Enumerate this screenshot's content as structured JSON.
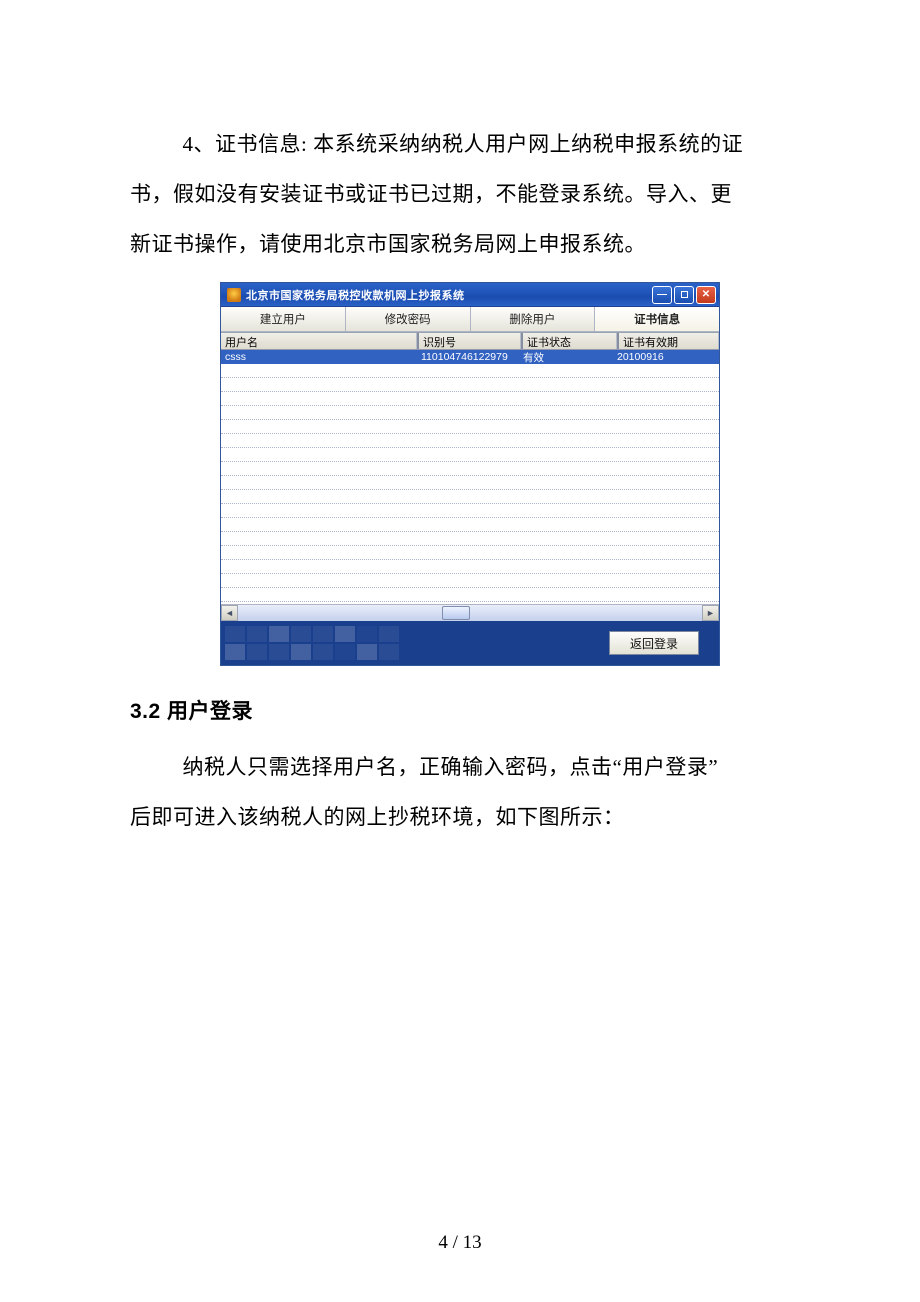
{
  "doc": {
    "p1_indent": "4、证书信息: 本系统采纳纳税人用户网上纳税申报系统的证",
    "p1_l2": "书，假如没有安装证书或证书已过期，不能登录系统。导入、更",
    "p1_l3": "新证书操作，请使用北京市国家税务局网上申报系统。",
    "h32": "3.2 用户登录",
    "p2_indent": "纳税人只需选择用户名，正确输入密码，点击“用户登录”",
    "p2_l2": "后即可进入该纳税人的网上抄税环境，如下图所示：",
    "pagenum": "4 / 13"
  },
  "win": {
    "title": "北京市国家税务局税控收款机网上抄报系统",
    "tabs": {
      "create": "建立用户",
      "changepw": "修改密码",
      "delete": "删除用户",
      "cert": "证书信息"
    },
    "columns": {
      "user": "用户名",
      "id": "识别号",
      "status": "证书状态",
      "expiry": "证书有效期"
    },
    "row0": {
      "user": "csss",
      "id": "110104746122979",
      "status": "有效",
      "expiry": "20100916"
    },
    "back": "返回登录",
    "ctl": {
      "min_glyph": "—",
      "close_glyph": "✕"
    }
  }
}
